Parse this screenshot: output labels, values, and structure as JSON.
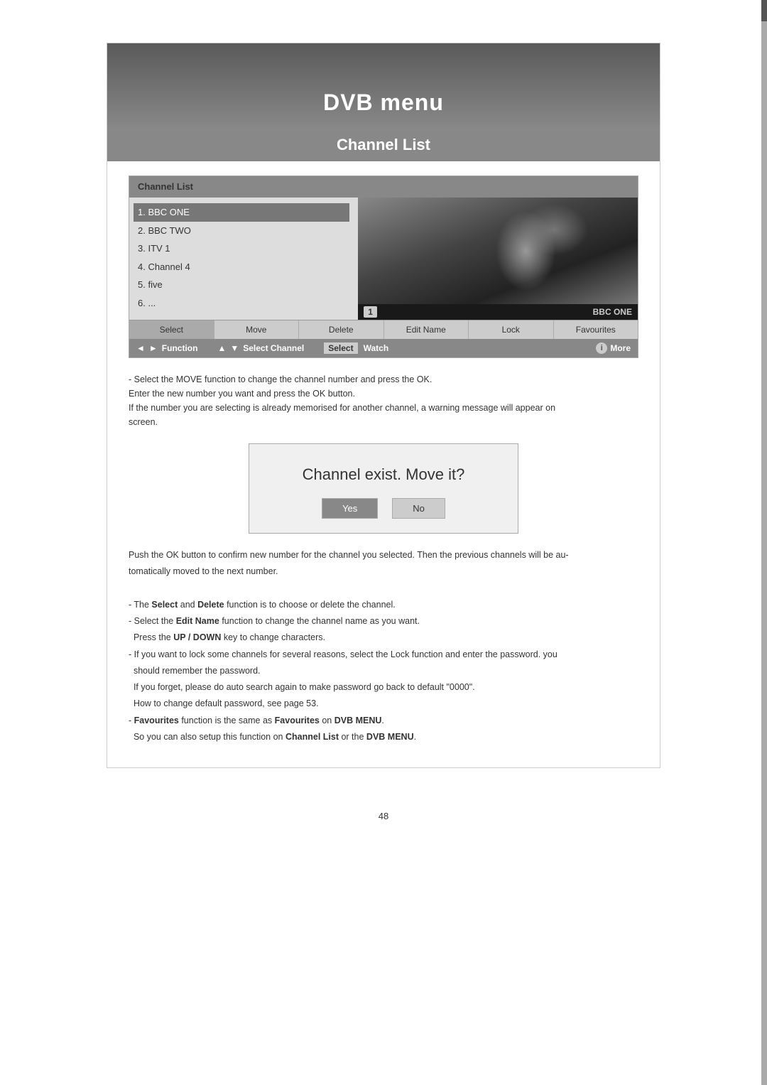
{
  "page": {
    "number": "48",
    "background_color": "#ffffff"
  },
  "dvb_menu": {
    "title": "DVB menu",
    "subtitle": "Channel List"
  },
  "channel_list_ui": {
    "header_label": "Channel List",
    "channels": [
      {
        "number": "1",
        "name": "BBC ONE",
        "selected": true
      },
      {
        "number": "2",
        "name": "BBC TWO",
        "selected": false
      },
      {
        "number": "3",
        "name": "ITV 1",
        "selected": false
      },
      {
        "number": "4",
        "name": "Channel 4",
        "selected": false
      },
      {
        "number": "5",
        "name": "five",
        "selected": false
      },
      {
        "number": "6",
        "name": "...",
        "selected": false
      }
    ],
    "preview_channel_number": "1",
    "preview_channel_name": "BBC ONE",
    "action_buttons": [
      {
        "label": "Select",
        "active": true
      },
      {
        "label": "Move",
        "active": false
      },
      {
        "label": "Delete",
        "active": false
      },
      {
        "label": "Edit Name",
        "active": false
      },
      {
        "label": "Lock",
        "active": false
      },
      {
        "label": "Favourites",
        "active": false
      }
    ],
    "nav_row": {
      "left_right_label": "Function",
      "up_down_label": "Select Channel",
      "select_label": "Select",
      "watch_label": "Watch",
      "info_label": "i",
      "more_label": "More"
    }
  },
  "instructions_above_dialog": {
    "line1": "- Select the MOVE function to change the channel number and press the OK.",
    "line2": "  Enter the new number you want and press the OK button.",
    "line3": "  If the number you are selecting is already memorised for another channel, a warning message will appear on",
    "line4": "screen."
  },
  "dialog": {
    "title": "Channel exist. Move it?",
    "yes_label": "Yes",
    "no_label": "No"
  },
  "instructions_below_dialog": {
    "line1": "Push the OK button to confirm new number for the channel you selected. Then the previous channels will be au-",
    "line2": "tomatically moved to the next number.",
    "line3": "",
    "line4": "- The Select and Delete function is to choose or delete the channel.",
    "line5": "- Select the Edit Name function to change the channel name as you want.",
    "line6": "  Press the UP / DOWN key to change characters.",
    "line7": "- If you want to lock some channels for several reasons, select the Lock function and enter the password. you",
    "line8": "  should remember the password.",
    "line9": "  If you forget, please do auto search again to make password go back to default \"0000\".",
    "line10": "  How to change default password, see page 53.",
    "line11": "- Favourites function is the same as Favourites on DVB MENU.",
    "line12": "  So you can also setup this function on Channel List or the DVB MENU."
  }
}
